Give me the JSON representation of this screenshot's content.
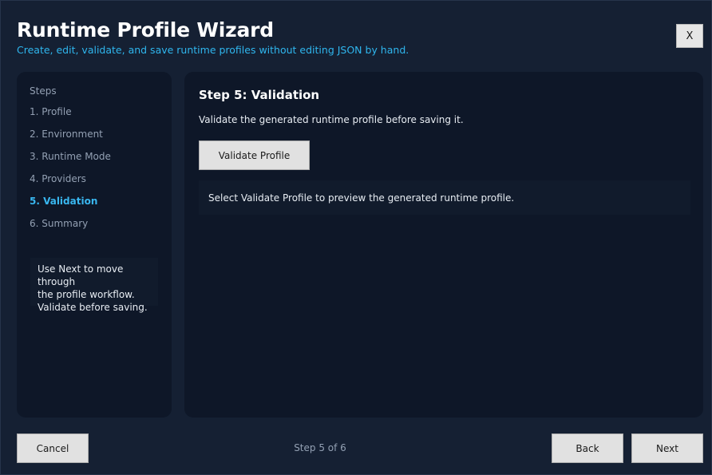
{
  "header": {
    "title": "Runtime Profile Wizard",
    "subtitle": "Create, edit, validate, and save runtime profiles without editing JSON by hand.",
    "close_label": "X"
  },
  "sidebar": {
    "heading": "Steps",
    "items": [
      {
        "label": "1. Profile",
        "active": false
      },
      {
        "label": "2. Environment",
        "active": false
      },
      {
        "label": "3. Runtime Mode",
        "active": false
      },
      {
        "label": "4. Providers",
        "active": false
      },
      {
        "label": "5. Validation",
        "active": true
      },
      {
        "label": "6. Summary",
        "active": false
      }
    ],
    "hint_lines": [
      "Use Next to move through",
      "the profile workflow.",
      "Validate before saving."
    ]
  },
  "main": {
    "step_title": "Step 5: Validation",
    "description": "Validate the generated runtime profile before saving it.",
    "validate_button_label": "Validate Profile",
    "result_text": "Select Validate Profile to preview the generated runtime profile."
  },
  "footer": {
    "cancel_label": "Cancel",
    "step_counter": "Step 5 of 6",
    "back_label": "Back",
    "next_label": "Next"
  },
  "colors": {
    "window_background": "#152033",
    "panel_background": "#0e1728",
    "accent": "#39b7f0",
    "subtitle": "#2fb6ee",
    "muted_text": "#93a0b3",
    "button_background": "#e1e1e1"
  }
}
